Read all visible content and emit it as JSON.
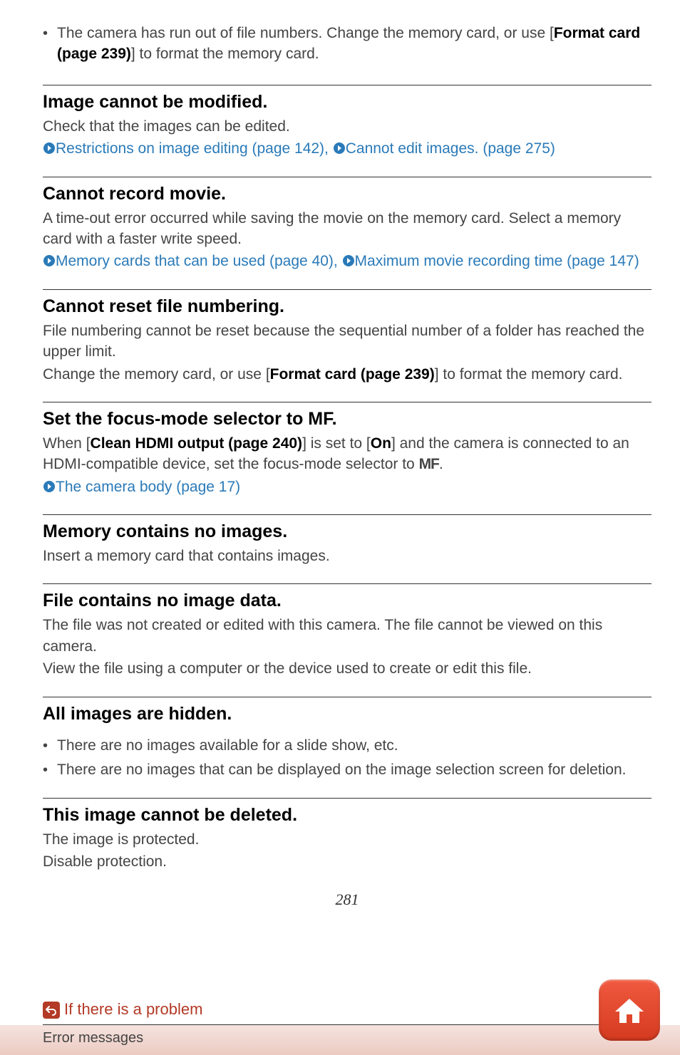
{
  "intro_bullet": {
    "prefix": "The camera has run out of file numbers. Change the memory card, or use [",
    "link": "Format card (page 239)",
    "suffix": "] to format the memory card."
  },
  "sections": {
    "s1": {
      "title": "Image cannot be modified.",
      "body1": "Check that the images can be edited.",
      "link1": "Restrictions on image editing (page 142)",
      "sep": ", ",
      "link2": "Cannot edit images. (page 275)"
    },
    "s2": {
      "title": "Cannot record movie.",
      "body1": "A time-out error occurred while saving the movie on the memory card. Select a memory card with a faster write speed.",
      "link1": "Memory cards that can be used (page 40)",
      "sep": ", ",
      "link2": "Maximum movie recording time (page 147)"
    },
    "s3": {
      "title": "Cannot reset file numbering.",
      "body1": "File numbering cannot be reset because the sequential number of a folder has reached the upper limit.",
      "mix_prefix": "Change the memory card, or use [",
      "mix_bold": "Format card (page 239)",
      "mix_suffix": "] to format the memory card."
    },
    "s4": {
      "title": "Set the focus-mode selector to MF.",
      "mix_prefix": "When [",
      "mix_bold1": "Clean HDMI output (page 240)",
      "mix_mid1": "] is set to [",
      "mix_bold2": "On",
      "mix_mid2": "] and the camera is connected to an HDMI-compatible device, set the focus-mode selector to ",
      "mf": "MF",
      "mix_suffix": ".",
      "link1": "The camera body (page 17)"
    },
    "s5": {
      "title": "Memory contains no images.",
      "body1": "Insert a memory card that contains images."
    },
    "s6": {
      "title": "File contains no image data.",
      "body1": "The file was not created or edited with this camera. The file cannot be viewed on this camera.",
      "body2": "View the file using a computer or the device used to create or edit this file."
    },
    "s7": {
      "title": "All images are hidden.",
      "bullets": [
        "There are no images available for a slide show, etc.",
        "There are no images that can be displayed on the image selection screen for deletion."
      ]
    },
    "s8": {
      "title": "This image cannot be deleted.",
      "body1": "The image is protected.",
      "body2": "Disable protection."
    }
  },
  "page_number": "281",
  "footer": {
    "back_label": "If there is a problem",
    "breadcrumb": "Error messages"
  }
}
